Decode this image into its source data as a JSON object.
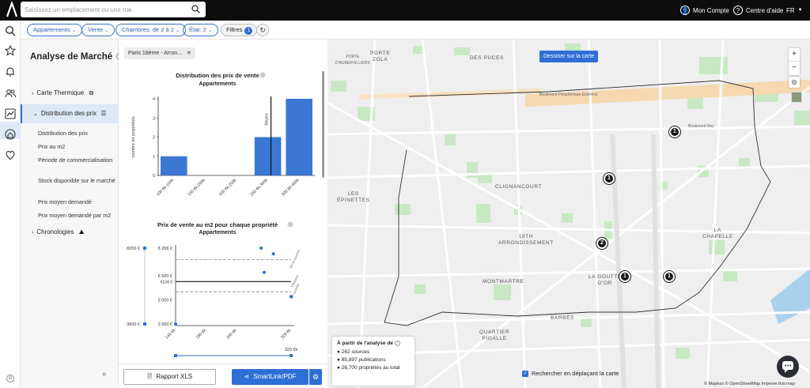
{
  "topbar": {
    "search_placeholder": "Saisissez un emplacement ou une rue.",
    "account_label": "Mon Compte",
    "help_label": "Centre d'aide",
    "lang_label": "FR"
  },
  "filters": {
    "items": [
      {
        "label": "Appartements"
      },
      {
        "label": "Vente"
      },
      {
        "label": "Chambres: de 2 à 2"
      },
      {
        "label": "État: 2"
      }
    ],
    "filtres_label": "Filtres",
    "filtres_count": "1"
  },
  "sidebar": {
    "title": "Analyse de Marché",
    "sections": [
      {
        "label": "Carte Thermique"
      },
      {
        "label": "Distribution des prix"
      },
      {
        "label": "Chronologies"
      }
    ],
    "subitems": [
      {
        "label": "Distribution des prix"
      },
      {
        "label": "Prix au m2"
      },
      {
        "label": "Période de commercialisation"
      },
      {
        "label": "Stock disponible sur le marché"
      },
      {
        "label": "Prix moyen demandé"
      },
      {
        "label": "Prix moyen demandé par m2"
      }
    ]
  },
  "content": {
    "tag_label": "Paris 18ème - Arron...",
    "export_xls_label": "Rapport XLS",
    "smartlink_label": "SmartLink/PDF"
  },
  "chart_data": [
    {
      "type": "bar",
      "title": "Distribution des prix de vente",
      "subtitle": "Appartements",
      "ylabel": "nombre de propriétés",
      "categories": [
        "100 €k-150k",
        "150 €k-200k",
        "200 €k-250k",
        "250 €k-300k",
        "300 €k-400k"
      ],
      "values": [
        1,
        0,
        0,
        2,
        4
      ],
      "ylim": [
        0,
        4
      ],
      "yticks": [
        "0",
        "1",
        "2",
        "3",
        "4"
      ],
      "annotations": [
        {
          "label": "Moyen"
        }
      ]
    },
    {
      "type": "scatter",
      "title": "Prix de vente au m2 pour chaque propriété",
      "subtitle": "Appartements",
      "ylim": [
        3500,
        8206
      ],
      "yticks": [
        "3 500 €",
        "5 000 €",
        "6 500 €",
        "8 206 €"
      ],
      "xticks": [
        "140 €k",
        "190 €k",
        "240 €k",
        "329 €k"
      ],
      "x_range_max_label": "329 €k",
      "y_range_labels": [
        "8206 €",
        "3500 €"
      ],
      "median_label": "6134 €",
      "median": 6134,
      "upper_quartile": 7500,
      "lower_quartile": 5500,
      "line_labels": [
        "3ème quartile",
        "Médiane",
        "1er quartile"
      ],
      "points": [
        {
          "x": 140,
          "y": 3500
        },
        {
          "x": 280,
          "y": 8206
        },
        {
          "x": 285,
          "y": 6700
        },
        {
          "x": 300,
          "y": 7850
        },
        {
          "x": 329,
          "y": 5200
        }
      ],
      "xlim": [
        140,
        329
      ]
    }
  ],
  "map": {
    "draw_label": "Dessiner sur la carte",
    "labels": [
      {
        "text": "PORTE\nD'AUBERVILLIERS"
      },
      {
        "text": "PORTE\nZOLA"
      },
      {
        "text": "DES PUCES"
      },
      {
        "text": "CLIGNANCOURT"
      },
      {
        "text": "LES\nÉPINETTES"
      },
      {
        "text": "18TH\nARRONDISSEMENT"
      },
      {
        "text": "MONTMARTRE"
      },
      {
        "text": "LA GOUTTE\nD'OR"
      },
      {
        "text": "LA\nCHAPELLE"
      },
      {
        "text": "QUARTIER\nPIGALLE"
      },
      {
        "text": "BARBÈS"
      },
      {
        "text": "Boulevard Ney"
      },
      {
        "text": "Boulevard Périphérique Extérieur"
      }
    ],
    "clusters": [
      {
        "count": "1"
      },
      {
        "count": "1"
      },
      {
        "count": "2"
      },
      {
        "count": "1"
      },
      {
        "count": "1"
      }
    ],
    "info_title": "À partir de l'analyse de",
    "info_lines": [
      {
        "text": "262 sources"
      },
      {
        "text": "85,897 publications"
      },
      {
        "text": "26,700 propriétés au total"
      }
    ],
    "search_move_label": "Rechercher en déplaçant la carte",
    "attribution": "© Mapbox © OpenStreetMap Improve this map",
    "zoom_in": "+",
    "zoom_out": "−"
  },
  "colors": {
    "accent": "#2e6fd6",
    "bar": "#3a78d4",
    "topbar": "#0d0d0d",
    "park": "#c8e8c4"
  }
}
